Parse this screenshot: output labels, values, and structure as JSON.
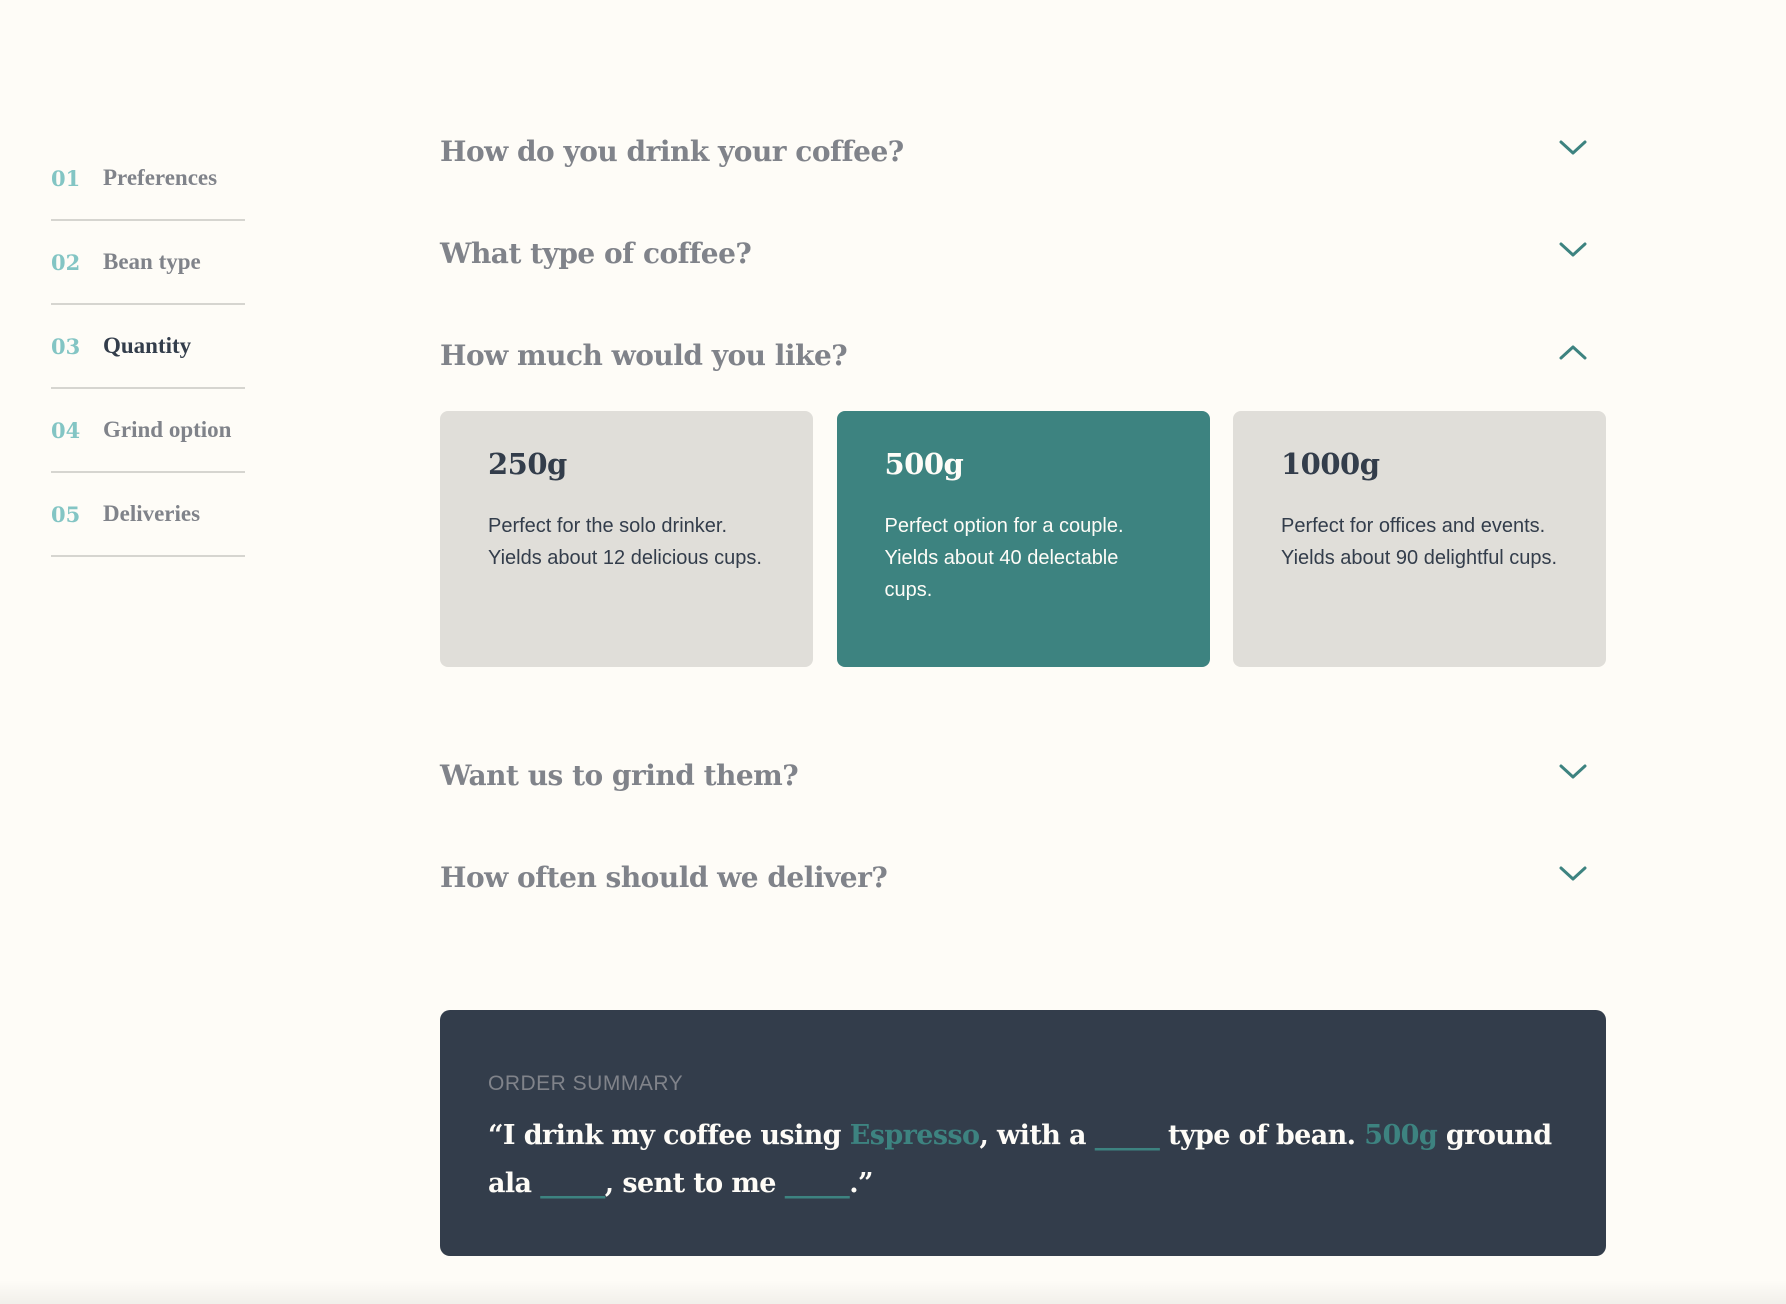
{
  "sidebar": {
    "items": [
      {
        "num": "01",
        "label": "Preferences"
      },
      {
        "num": "02",
        "label": "Bean type"
      },
      {
        "num": "03",
        "label": "Quantity"
      },
      {
        "num": "04",
        "label": "Grind option"
      },
      {
        "num": "05",
        "label": "Deliveries"
      }
    ],
    "active_index": 2
  },
  "questions": [
    {
      "title": "How do you drink your coffee?",
      "expanded": false,
      "icon": "chevron-down-icon"
    },
    {
      "title": "What type of coffee?",
      "expanded": false,
      "icon": "chevron-down-icon"
    },
    {
      "title": "How much would you like?",
      "expanded": true,
      "icon": "chevron-up-icon"
    },
    {
      "title": "Want us to grind them?",
      "expanded": false,
      "icon": "chevron-down-icon"
    },
    {
      "title": "How often should we deliver?",
      "expanded": false,
      "icon": "chevron-down-icon"
    }
  ],
  "quantity_options": [
    {
      "title": "250g",
      "desc": "Perfect for the solo drinker. Yields about 12 delicious cups.",
      "selected": false
    },
    {
      "title": "500g",
      "desc": "Perfect option for a couple. Yields about 40 delectable cups.",
      "selected": true
    },
    {
      "title": "1000g",
      "desc": "Perfect for offices and events. Yields about 90 delightful cups.",
      "selected": false
    }
  ],
  "summary": {
    "heading": "ORDER SUMMARY",
    "p1": "“I drink my coffee using ",
    "drink": "Espresso",
    "p2": ", with a ",
    "bean": "_____",
    "p3": " type of bean. ",
    "qty": "500g",
    "p4": " ground ala ",
    "grind": "_____",
    "p5": ", sent to me ",
    "delivery": "_____",
    "p6": ".”"
  },
  "colors": {
    "background": "#FEFCF7",
    "accent": "#3D8380",
    "accent_light": "#83C5C4",
    "dark": "#333D4B",
    "muted": "#80838A",
    "card": "#E0DED9"
  }
}
